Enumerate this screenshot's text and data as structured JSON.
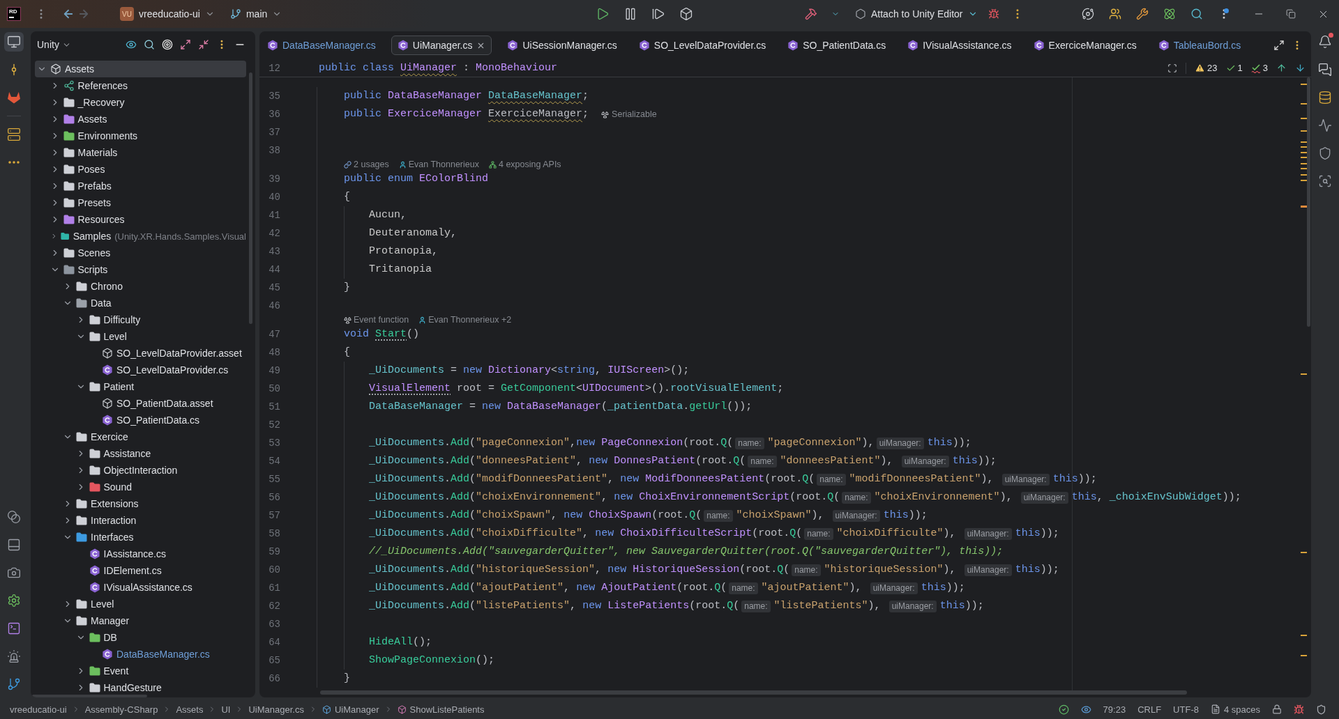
{
  "title_bar": {
    "logo": "RD",
    "navigation": [
      {
        "kind": "back",
        "disabled": false
      },
      {
        "kind": "forward",
        "disabled": true
      }
    ],
    "project": {
      "avatar": "VU",
      "name": "vreeducatio-ui"
    },
    "branch": "main",
    "run_configuration": "Attach to Unity Editor",
    "updates_badge": true
  },
  "left_toolbar": {
    "top_groups": [
      [
        {
          "kind": "project",
          "selected": true
        },
        {
          "kind": "commit",
          "selected": false
        },
        {
          "kind": "gitlab",
          "selected": false
        }
      ],
      [
        {
          "kind": "structure",
          "selected": false
        },
        {
          "kind": "more",
          "selected": false
        }
      ]
    ],
    "bottom": [
      {
        "kind": "services",
        "selected": false
      },
      {
        "kind": "layout",
        "selected": false
      },
      {
        "kind": "capture",
        "selected": false
      },
      {
        "kind": "settings",
        "selected": false
      },
      {
        "kind": "terminal",
        "selected": false
      },
      {
        "kind": "problems",
        "selected": false
      },
      {
        "kind": "git",
        "selected": false
      }
    ]
  },
  "project_panel": {
    "title": "Unity",
    "tree": [
      {
        "label": "Assets",
        "kind": "unity",
        "expanded": true,
        "selected": true,
        "modified": false,
        "children": [
          {
            "label": "References",
            "kind": "references",
            "expanded": false,
            "selected": false,
            "modified": false
          },
          {
            "label": "_Recovery",
            "kind": "folder",
            "color": "#ced0d6",
            "expanded": false,
            "selected": false,
            "modified": false
          },
          {
            "label": "Assets",
            "kind": "folder",
            "color": "#b180e8",
            "expanded": false,
            "selected": false,
            "modified": false
          },
          {
            "label": "Environments",
            "kind": "folder",
            "color": "#6cbf5e",
            "expanded": false,
            "selected": false,
            "modified": false
          },
          {
            "label": "Materials",
            "kind": "folder",
            "color": "#ced0d6",
            "expanded": false,
            "selected": false,
            "modified": false
          },
          {
            "label": "Poses",
            "kind": "folder",
            "color": "#ced0d6",
            "expanded": false,
            "selected": false,
            "modified": false
          },
          {
            "label": "Prefabs",
            "kind": "folder",
            "color": "#ced0d6",
            "expanded": false,
            "selected": false,
            "modified": false
          },
          {
            "label": "Presets",
            "kind": "folder",
            "color": "#ced0d6",
            "expanded": false,
            "selected": false,
            "modified": false
          },
          {
            "label": "Resources",
            "kind": "folder",
            "color": "#b180e8",
            "expanded": false,
            "selected": false,
            "modified": false
          },
          {
            "label": "Samples",
            "hint": "(Unity.XR.Hands.Samples.Visual",
            "kind": "folder",
            "color": "#2fb5a8",
            "expanded": false,
            "selected": false,
            "modified": false
          },
          {
            "label": "Scenes",
            "kind": "folder",
            "color": "#ced0d6",
            "expanded": false,
            "selected": false,
            "modified": false
          },
          {
            "label": "Scripts",
            "kind": "folder",
            "color": "#8d959f",
            "expanded": true,
            "selected": false,
            "modified": false,
            "children": [
              {
                "label": "Chrono",
                "kind": "folder",
                "color": "#ced0d6",
                "expanded": false,
                "selected": false,
                "modified": false
              },
              {
                "label": "Data",
                "kind": "folder",
                "color": "#9ba1a9",
                "expanded": true,
                "selected": false,
                "modified": false,
                "children": [
                  {
                    "label": "Difficulty",
                    "kind": "folder",
                    "color": "#ced0d6",
                    "expanded": false,
                    "selected": false,
                    "modified": false
                  },
                  {
                    "label": "Level",
                    "kind": "folder",
                    "color": "#ced0d6",
                    "expanded": true,
                    "selected": false,
                    "modified": false,
                    "children": [
                      {
                        "label": "SO_LevelDataProvider.asset",
                        "kind": "asset",
                        "selected": false,
                        "modified": false
                      },
                      {
                        "label": "SO_LevelDataProvider.cs",
                        "kind": "csharp",
                        "selected": false,
                        "modified": false
                      }
                    ]
                  },
                  {
                    "label": "Patient",
                    "kind": "folder",
                    "color": "#ced0d6",
                    "expanded": true,
                    "selected": false,
                    "modified": false,
                    "children": [
                      {
                        "label": "SO_PatientData.asset",
                        "kind": "asset",
                        "selected": false,
                        "modified": false
                      },
                      {
                        "label": "SO_PatientData.cs",
                        "kind": "csharp",
                        "selected": false,
                        "modified": false
                      }
                    ]
                  }
                ]
              },
              {
                "label": "Exercice",
                "kind": "folder",
                "color": "#ced0d6",
                "expanded": true,
                "selected": false,
                "modified": false,
                "children": [
                  {
                    "label": "Assistance",
                    "kind": "folder",
                    "color": "#ced0d6",
                    "expanded": false,
                    "selected": false,
                    "modified": false
                  },
                  {
                    "label": "ObjectInteraction",
                    "kind": "folder",
                    "color": "#ced0d6",
                    "expanded": false,
                    "selected": false,
                    "modified": false
                  },
                  {
                    "label": "Sound",
                    "kind": "folder",
                    "color": "#e5565f",
                    "expanded": false,
                    "selected": false,
                    "modified": false
                  }
                ]
              },
              {
                "label": "Extensions",
                "kind": "folder",
                "color": "#ced0d6",
                "expanded": false,
                "selected": false,
                "modified": false
              },
              {
                "label": "Interaction",
                "kind": "folder",
                "color": "#ced0d6",
                "expanded": false,
                "selected": false,
                "modified": false
              },
              {
                "label": "Interfaces",
                "kind": "folder",
                "color": "#3d9ae0",
                "expanded": true,
                "selected": false,
                "modified": false,
                "children": [
                  {
                    "label": "IAssistance.cs",
                    "kind": "csharp",
                    "selected": false,
                    "modified": false
                  },
                  {
                    "label": "IDElement.cs",
                    "kind": "csharp",
                    "selected": false,
                    "modified": false
                  },
                  {
                    "label": "IVisualAssistance.cs",
                    "kind": "csharp",
                    "selected": false,
                    "modified": false
                  }
                ]
              },
              {
                "label": "Level",
                "kind": "folder",
                "color": "#ced0d6",
                "expanded": false,
                "selected": false,
                "modified": false
              },
              {
                "label": "Manager",
                "kind": "folder",
                "color": "#ced0d6",
                "expanded": true,
                "selected": false,
                "modified": false,
                "children": [
                  {
                    "label": "DB",
                    "kind": "folder",
                    "color": "#6cbf5e",
                    "expanded": true,
                    "selected": false,
                    "modified": false,
                    "children": [
                      {
                        "label": "DataBaseManager.cs",
                        "kind": "csharp",
                        "selected": false,
                        "modified": true
                      }
                    ]
                  },
                  {
                    "label": "Event",
                    "kind": "folder",
                    "color": "#6cbf5e",
                    "expanded": false,
                    "selected": false,
                    "modified": false
                  },
                  {
                    "label": "HandGesture",
                    "kind": "folder",
                    "color": "#ced0d6",
                    "expanded": false,
                    "selected": false,
                    "modified": false
                  }
                ]
              }
            ]
          }
        ]
      }
    ]
  },
  "editor": {
    "tabs": [
      {
        "label": "DataBaseManager.cs",
        "selected": false,
        "modified": true
      },
      {
        "label": "UiManager.cs",
        "selected": true,
        "modified": false
      },
      {
        "label": "UiSessionManager.cs",
        "selected": false,
        "modified": false
      },
      {
        "label": "SO_LevelDataProvider.cs",
        "selected": false,
        "modified": false
      },
      {
        "label": "SO_PatientData.cs",
        "selected": false,
        "modified": false
      },
      {
        "label": "IVisualAssistance.cs",
        "selected": false,
        "modified": false
      },
      {
        "label": "ExerciceManager.cs",
        "selected": false,
        "modified": false
      },
      {
        "label": "TableauBord.cs",
        "selected": false,
        "modified": true
      }
    ],
    "sticky_line": {
      "number": "12",
      "tokens": [
        {
          "kind": "kw",
          "text": "public class "
        },
        {
          "kind": "type-warned",
          "text": "UiManager"
        },
        {
          "kind": "plain",
          "text": " : "
        },
        {
          "kind": "type",
          "text": "MonoBehaviour"
        }
      ]
    },
    "inspections": [
      {
        "kind": "warning",
        "count": "23"
      },
      {
        "kind": "weak",
        "count": "1"
      },
      {
        "kind": "typo",
        "count": "3"
      }
    ],
    "rows": [
      {
        "kind": "code",
        "number": "35",
        "tokens": [
          {
            "kind": "kw",
            "text": "public "
          },
          {
            "kind": "type",
            "text": "DataBaseManager "
          },
          {
            "kind": "field-warned",
            "text": "DataBaseManager"
          },
          {
            "kind": "plain",
            "text": ";"
          }
        ]
      },
      {
        "kind": "code",
        "number": "36",
        "tokens": [
          {
            "kind": "kw",
            "text": "public "
          },
          {
            "kind": "type",
            "text": "ExerciceManager "
          },
          {
            "kind": "plain-warned",
            "text": "ExerciceManager"
          },
          {
            "kind": "plain",
            "text": ";"
          }
        ],
        "annotation": "Serializable"
      },
      {
        "kind": "code",
        "number": "37"
      },
      {
        "kind": "code",
        "number": "38"
      },
      {
        "kind": "lens",
        "items": [
          {
            "kind": "usages",
            "text": "2 usages"
          },
          {
            "kind": "author",
            "text": "Evan Thonnerieux"
          },
          {
            "kind": "apis",
            "text": "4 exposing APIs"
          }
        ]
      },
      {
        "kind": "code",
        "number": "39",
        "tokens": [
          {
            "kind": "kw",
            "text": "public enum "
          },
          {
            "kind": "type",
            "text": "EColorBlind"
          }
        ]
      },
      {
        "kind": "code",
        "number": "40",
        "tokens": [
          {
            "kind": "plain",
            "text": "{"
          }
        ]
      },
      {
        "kind": "block",
        "children": [
          {
            "kind": "code",
            "number": "41",
            "tokens": [
              {
                "kind": "member",
                "text": "Aucun"
              },
              {
                "kind": "plain",
                "text": ","
              }
            ]
          },
          {
            "kind": "code",
            "number": "42",
            "tokens": [
              {
                "kind": "member",
                "text": "Deuteranomaly"
              },
              {
                "kind": "plain",
                "text": ","
              }
            ]
          },
          {
            "kind": "code",
            "number": "43",
            "tokens": [
              {
                "kind": "member",
                "text": "Protanopia"
              },
              {
                "kind": "plain",
                "text": ","
              }
            ]
          },
          {
            "kind": "code",
            "number": "44",
            "tokens": [
              {
                "kind": "member",
                "text": "Tritanopia"
              }
            ]
          }
        ]
      },
      {
        "kind": "code",
        "number": "45",
        "tokens": [
          {
            "kind": "plain",
            "text": "}"
          }
        ]
      },
      {
        "kind": "code",
        "number": "46"
      },
      {
        "kind": "lens",
        "items": [
          {
            "kind": "event",
            "text": "Event function"
          },
          {
            "kind": "author",
            "text": "Evan Thonnerieux +2"
          }
        ]
      },
      {
        "kind": "code",
        "number": "47",
        "tokens": [
          {
            "kind": "kw",
            "text": "void "
          },
          {
            "kind": "method-dotted",
            "text": "Start"
          },
          {
            "kind": "plain",
            "text": "()"
          }
        ]
      },
      {
        "kind": "code",
        "number": "48",
        "tokens": [
          {
            "kind": "plain",
            "text": "{"
          }
        ]
      },
      {
        "kind": "block",
        "children": [
          {
            "kind": "code",
            "number": "49",
            "tokens": [
              {
                "kind": "field",
                "text": "_UiDocuments"
              },
              {
                "kind": "plain",
                "text": " = "
              },
              {
                "kind": "kw",
                "text": "new "
              },
              {
                "kind": "type",
                "text": "Dictionary"
              },
              {
                "kind": "plain",
                "text": "<"
              },
              {
                "kind": "kw",
                "text": "string"
              },
              {
                "kind": "plain",
                "text": ", "
              },
              {
                "kind": "type",
                "text": "IUIScreen"
              },
              {
                "kind": "plain",
                "text": ">();"
              }
            ]
          },
          {
            "kind": "code",
            "number": "50",
            "tokens": [
              {
                "kind": "type-dotted",
                "text": "VisualElement"
              },
              {
                "kind": "plain",
                "text": " root = "
              },
              {
                "kind": "method",
                "text": "GetComponent"
              },
              {
                "kind": "plain",
                "text": "<"
              },
              {
                "kind": "type",
                "text": "UIDocument"
              },
              {
                "kind": "plain",
                "text": ">()."
              },
              {
                "kind": "field",
                "text": "rootVisualElement"
              },
              {
                "kind": "plain",
                "text": ";"
              }
            ]
          },
          {
            "kind": "code",
            "number": "51",
            "tokens": [
              {
                "kind": "field",
                "text": "DataBaseManager"
              },
              {
                "kind": "plain",
                "text": " = "
              },
              {
                "kind": "kw",
                "text": "new "
              },
              {
                "kind": "type",
                "text": "DataBaseManager"
              },
              {
                "kind": "plain",
                "text": "("
              },
              {
                "kind": "field",
                "text": "_patientData"
              },
              {
                "kind": "plain",
                "text": "."
              },
              {
                "kind": "method",
                "text": "getUrl"
              },
              {
                "kind": "plain",
                "text": "());"
              }
            ]
          },
          {
            "kind": "code",
            "number": "52"
          },
          {
            "kind": "code",
            "number": "53",
            "tokens": [
              {
                "kind": "field",
                "text": "_UiDocuments"
              },
              {
                "kind": "plain",
                "text": "."
              },
              {
                "kind": "method",
                "text": "Add"
              },
              {
                "kind": "plain",
                "text": "("
              },
              {
                "kind": "string",
                "text": "\"pageConnexion\""
              },
              {
                "kind": "plain",
                "text": ","
              },
              {
                "kind": "kw",
                "text": "new "
              },
              {
                "kind": "type",
                "text": "PageConnexion"
              },
              {
                "kind": "plain",
                "text": "(root."
              },
              {
                "kind": "method",
                "text": "Q"
              },
              {
                "kind": "plain",
                "text": "("
              },
              {
                "kind": "hint",
                "text": "name:"
              },
              {
                "kind": "string",
                "text": "\"pageConnexion\""
              },
              {
                "kind": "plain",
                "text": "),"
              },
              {
                "kind": "hint",
                "text": "uiManager:"
              },
              {
                "kind": "kw",
                "text": "this"
              },
              {
                "kind": "plain",
                "text": "));"
              }
            ]
          },
          {
            "kind": "code",
            "number": "54",
            "tokens": [
              {
                "kind": "field",
                "text": "_UiDocuments"
              },
              {
                "kind": "plain",
                "text": "."
              },
              {
                "kind": "method",
                "text": "Add"
              },
              {
                "kind": "plain",
                "text": "("
              },
              {
                "kind": "string",
                "text": "\"donneesPatient\""
              },
              {
                "kind": "plain",
                "text": ", "
              },
              {
                "kind": "kw",
                "text": "new "
              },
              {
                "kind": "type",
                "text": "DonnesPatient"
              },
              {
                "kind": "plain",
                "text": "(root."
              },
              {
                "kind": "method",
                "text": "Q"
              },
              {
                "kind": "plain",
                "text": "("
              },
              {
                "kind": "hint",
                "text": "name:"
              },
              {
                "kind": "string",
                "text": "\"donneesPatient\""
              },
              {
                "kind": "plain",
                "text": "), "
              },
              {
                "kind": "hint",
                "text": "uiManager:"
              },
              {
                "kind": "kw",
                "text": "this"
              },
              {
                "kind": "plain",
                "text": "));"
              }
            ]
          },
          {
            "kind": "code",
            "number": "55",
            "tokens": [
              {
                "kind": "field",
                "text": "_UiDocuments"
              },
              {
                "kind": "plain",
                "text": "."
              },
              {
                "kind": "method",
                "text": "Add"
              },
              {
                "kind": "plain",
                "text": "("
              },
              {
                "kind": "string",
                "text": "\"modifDonneesPatient\""
              },
              {
                "kind": "plain",
                "text": ", "
              },
              {
                "kind": "kw",
                "text": "new "
              },
              {
                "kind": "type",
                "text": "ModifDonneesPatient"
              },
              {
                "kind": "plain",
                "text": "(root."
              },
              {
                "kind": "method",
                "text": "Q"
              },
              {
                "kind": "plain",
                "text": "("
              },
              {
                "kind": "hint",
                "text": "name:"
              },
              {
                "kind": "string",
                "text": "\"modifDonneesPatient\""
              },
              {
                "kind": "plain",
                "text": "), "
              },
              {
                "kind": "hint",
                "text": "uiManager:"
              },
              {
                "kind": "kw",
                "text": "this"
              },
              {
                "kind": "plain",
                "text": "));"
              }
            ]
          },
          {
            "kind": "code",
            "number": "56",
            "tokens": [
              {
                "kind": "field",
                "text": "_UiDocuments"
              },
              {
                "kind": "plain",
                "text": "."
              },
              {
                "kind": "method",
                "text": "Add"
              },
              {
                "kind": "plain",
                "text": "("
              },
              {
                "kind": "string",
                "text": "\"choixEnvironnement\""
              },
              {
                "kind": "plain",
                "text": ", "
              },
              {
                "kind": "kw",
                "text": "new "
              },
              {
                "kind": "type",
                "text": "ChoixEnvironnementScript"
              },
              {
                "kind": "plain",
                "text": "(root."
              },
              {
                "kind": "method",
                "text": "Q"
              },
              {
                "kind": "plain",
                "text": "("
              },
              {
                "kind": "hint",
                "text": "name:"
              },
              {
                "kind": "string",
                "text": "\"choixEnvironnement\""
              },
              {
                "kind": "plain",
                "text": "), "
              },
              {
                "kind": "hint",
                "text": "uiManager:"
              },
              {
                "kind": "kw",
                "text": "this"
              },
              {
                "kind": "plain",
                "text": ", "
              },
              {
                "kind": "field",
                "text": "_choixEnvSubWidget"
              },
              {
                "kind": "plain",
                "text": "));"
              }
            ]
          },
          {
            "kind": "code",
            "number": "57",
            "tokens": [
              {
                "kind": "field",
                "text": "_UiDocuments"
              },
              {
                "kind": "plain",
                "text": "."
              },
              {
                "kind": "method",
                "text": "Add"
              },
              {
                "kind": "plain",
                "text": "("
              },
              {
                "kind": "string",
                "text": "\"choixSpawn\""
              },
              {
                "kind": "plain",
                "text": ", "
              },
              {
                "kind": "kw",
                "text": "new "
              },
              {
                "kind": "type",
                "text": "ChoixSpawn"
              },
              {
                "kind": "plain",
                "text": "(root."
              },
              {
                "kind": "method",
                "text": "Q"
              },
              {
                "kind": "plain",
                "text": "("
              },
              {
                "kind": "hint",
                "text": "name:"
              },
              {
                "kind": "string",
                "text": "\"choixSpawn\""
              },
              {
                "kind": "plain",
                "text": "), "
              },
              {
                "kind": "hint",
                "text": "uiManager:"
              },
              {
                "kind": "kw",
                "text": "this"
              },
              {
                "kind": "plain",
                "text": "));"
              }
            ]
          },
          {
            "kind": "code",
            "number": "58",
            "tokens": [
              {
                "kind": "field",
                "text": "_UiDocuments"
              },
              {
                "kind": "plain",
                "text": "."
              },
              {
                "kind": "method",
                "text": "Add"
              },
              {
                "kind": "plain",
                "text": "("
              },
              {
                "kind": "string",
                "text": "\"choixDifficulte\""
              },
              {
                "kind": "plain",
                "text": ", "
              },
              {
                "kind": "kw",
                "text": "new "
              },
              {
                "kind": "type",
                "text": "ChoixDifficulteScript"
              },
              {
                "kind": "plain",
                "text": "(root."
              },
              {
                "kind": "method",
                "text": "Q"
              },
              {
                "kind": "plain",
                "text": "("
              },
              {
                "kind": "hint",
                "text": "name:"
              },
              {
                "kind": "string",
                "text": "\"choixDifficulte\""
              },
              {
                "kind": "plain",
                "text": "), "
              },
              {
                "kind": "hint",
                "text": "uiManager:"
              },
              {
                "kind": "kw",
                "text": "this"
              },
              {
                "kind": "plain",
                "text": "));"
              }
            ]
          },
          {
            "kind": "code",
            "number": "59",
            "tokens": [
              {
                "kind": "comment",
                "text": "//_UiDocuments.Add(\"sauvegarderQuitter\", new SauvegarderQuitter(root.Q(\"sauvegarderQuitter\"), this));"
              }
            ]
          },
          {
            "kind": "code",
            "number": "60",
            "tokens": [
              {
                "kind": "field",
                "text": "_UiDocuments"
              },
              {
                "kind": "plain",
                "text": "."
              },
              {
                "kind": "method",
                "text": "Add"
              },
              {
                "kind": "plain",
                "text": "("
              },
              {
                "kind": "string",
                "text": "\"historiqueSession\""
              },
              {
                "kind": "plain",
                "text": ", "
              },
              {
                "kind": "kw",
                "text": "new "
              },
              {
                "kind": "type",
                "text": "HistoriqueSession"
              },
              {
                "kind": "plain",
                "text": "(root."
              },
              {
                "kind": "method",
                "text": "Q"
              },
              {
                "kind": "plain",
                "text": "("
              },
              {
                "kind": "hint",
                "text": "name:"
              },
              {
                "kind": "string",
                "text": "\"historiqueSession\""
              },
              {
                "kind": "plain",
                "text": "), "
              },
              {
                "kind": "hint",
                "text": "uiManager:"
              },
              {
                "kind": "kw",
                "text": "this"
              },
              {
                "kind": "plain",
                "text": "));"
              }
            ]
          },
          {
            "kind": "code",
            "number": "61",
            "tokens": [
              {
                "kind": "field",
                "text": "_UiDocuments"
              },
              {
                "kind": "plain",
                "text": "."
              },
              {
                "kind": "method",
                "text": "Add"
              },
              {
                "kind": "plain",
                "text": "("
              },
              {
                "kind": "string",
                "text": "\"ajoutPatient\""
              },
              {
                "kind": "plain",
                "text": ", "
              },
              {
                "kind": "kw",
                "text": "new "
              },
              {
                "kind": "type",
                "text": "AjoutPatient"
              },
              {
                "kind": "plain",
                "text": "(root."
              },
              {
                "kind": "method",
                "text": "Q"
              },
              {
                "kind": "plain",
                "text": "("
              },
              {
                "kind": "hint",
                "text": "name:"
              },
              {
                "kind": "string",
                "text": "\"ajoutPatient\""
              },
              {
                "kind": "plain",
                "text": "), "
              },
              {
                "kind": "hint",
                "text": "uiManager:"
              },
              {
                "kind": "kw",
                "text": "this"
              },
              {
                "kind": "plain",
                "text": "));"
              }
            ]
          },
          {
            "kind": "code",
            "number": "62",
            "tokens": [
              {
                "kind": "field",
                "text": "_UiDocuments"
              },
              {
                "kind": "plain",
                "text": "."
              },
              {
                "kind": "method",
                "text": "Add"
              },
              {
                "kind": "plain",
                "text": "("
              },
              {
                "kind": "string",
                "text": "\"listePatients\""
              },
              {
                "kind": "plain",
                "text": ", "
              },
              {
                "kind": "kw",
                "text": "new "
              },
              {
                "kind": "type",
                "text": "ListePatients"
              },
              {
                "kind": "plain",
                "text": "(root."
              },
              {
                "kind": "method",
                "text": "Q"
              },
              {
                "kind": "plain",
                "text": "("
              },
              {
                "kind": "hint",
                "text": "name:"
              },
              {
                "kind": "string",
                "text": "\"listePatients\""
              },
              {
                "kind": "plain",
                "text": "), "
              },
              {
                "kind": "hint",
                "text": "uiManager:"
              },
              {
                "kind": "kw",
                "text": "this"
              },
              {
                "kind": "plain",
                "text": "));"
              }
            ]
          },
          {
            "kind": "code",
            "number": "63"
          },
          {
            "kind": "code",
            "number": "64",
            "tokens": [
              {
                "kind": "method",
                "text": "HideAll"
              },
              {
                "kind": "plain",
                "text": "();"
              }
            ]
          },
          {
            "kind": "code",
            "number": "65",
            "tokens": [
              {
                "kind": "method",
                "text": "ShowPageConnexion"
              },
              {
                "kind": "plain",
                "text": "();"
              }
            ]
          }
        ]
      },
      {
        "kind": "code",
        "number": "66",
        "tokens": [
          {
            "kind": "plain",
            "text": "}"
          }
        ]
      }
    ]
  },
  "right_toolbar": [
    {
      "kind": "notifications",
      "selected": false,
      "badge": true
    },
    {
      "kind": "ai-chat",
      "selected": false,
      "badge": false
    },
    {
      "kind": "database",
      "selected": false,
      "badge": false
    },
    {
      "kind": "activity",
      "selected": false,
      "badge": false
    },
    {
      "kind": "shield",
      "selected": false,
      "badge": false
    },
    {
      "kind": "capture-area",
      "selected": false,
      "badge": false
    }
  ],
  "status_bar": {
    "breadcrumbs": [
      {
        "kind": "plain",
        "label": "vreeducatio-ui"
      },
      {
        "kind": "plain",
        "label": "Assembly-CSharp"
      },
      {
        "kind": "plain",
        "label": "Assets"
      },
      {
        "kind": "plain",
        "label": "UI"
      },
      {
        "kind": "plain",
        "label": "UiManager.cs"
      },
      {
        "kind": "class",
        "label": "UiManager"
      },
      {
        "kind": "method",
        "label": "ShowListePatients"
      }
    ],
    "caret": "79:23",
    "line_separator": "CRLF",
    "encoding": "UTF-8",
    "indent": "4 spaces"
  }
}
